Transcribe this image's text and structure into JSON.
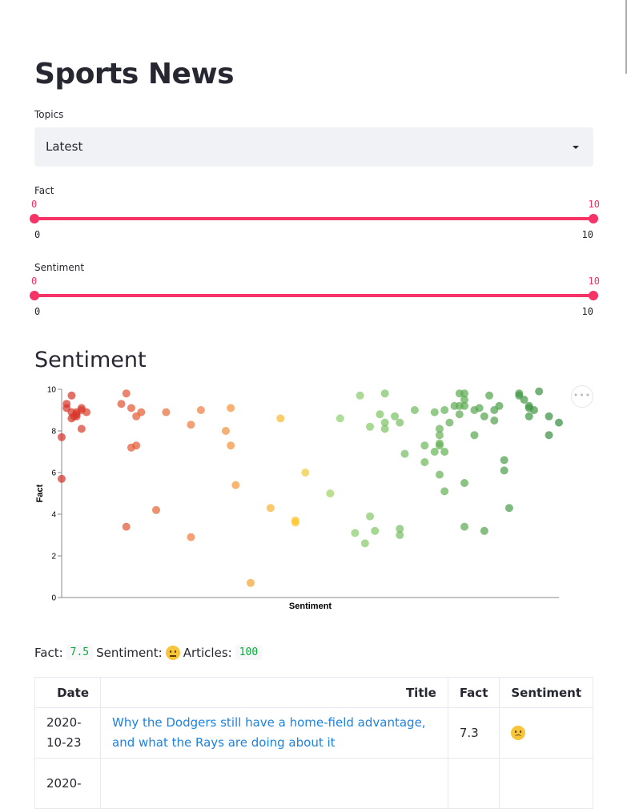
{
  "page": {
    "title": "Sports News"
  },
  "topics": {
    "label": "Topics",
    "selected": "Latest"
  },
  "sliders": [
    {
      "label": "Fact",
      "min": 0,
      "max": 10,
      "low": 0,
      "high": 10,
      "low_label": "0",
      "high_label": "10",
      "min_label": "0",
      "max_label": "10"
    },
    {
      "label": "Sentiment",
      "min": 0,
      "max": 10,
      "low": 0,
      "high": 10,
      "low_label": "0",
      "high_label": "10",
      "min_label": "0",
      "max_label": "10"
    }
  ],
  "section": {
    "heading": "Sentiment",
    "menu_icon": "ellipsis-icon"
  },
  "chart_data": {
    "type": "scatter",
    "title": "",
    "xlabel": "Sentiment",
    "ylabel": "Fact",
    "xlim": [
      0,
      10
    ],
    "ylim": [
      0,
      10
    ],
    "yticks": [
      "0",
      "2",
      "4",
      "6",
      "8",
      "10"
    ],
    "grid": false,
    "color_scale": "red-yellow-green by Sentiment",
    "points": [
      [
        0.0,
        7.7
      ],
      [
        0.0,
        5.7
      ],
      [
        0.1,
        9.3
      ],
      [
        0.1,
        9.1
      ],
      [
        0.2,
        9.7
      ],
      [
        0.2,
        8.9
      ],
      [
        0.2,
        8.6
      ],
      [
        0.25,
        8.7
      ],
      [
        0.3,
        8.9
      ],
      [
        0.3,
        8.7
      ],
      [
        0.3,
        8.8
      ],
      [
        0.4,
        9.1
      ],
      [
        0.4,
        9.0
      ],
      [
        0.4,
        8.1
      ],
      [
        0.5,
        8.9
      ],
      [
        1.2,
        9.3
      ],
      [
        1.3,
        9.8
      ],
      [
        1.4,
        9.1
      ],
      [
        1.5,
        8.7
      ],
      [
        1.6,
        8.9
      ],
      [
        1.4,
        7.2
      ],
      [
        1.5,
        7.3
      ],
      [
        1.3,
        3.4
      ],
      [
        1.9,
        4.2
      ],
      [
        2.1,
        8.9
      ],
      [
        2.6,
        8.3
      ],
      [
        2.8,
        9.0
      ],
      [
        2.6,
        2.9
      ],
      [
        3.3,
        8.0
      ],
      [
        3.4,
        9.1
      ],
      [
        3.4,
        7.3
      ],
      [
        3.5,
        5.4
      ],
      [
        3.8,
        0.7
      ],
      [
        4.2,
        4.3
      ],
      [
        4.4,
        8.6
      ],
      [
        4.7,
        3.7
      ],
      [
        4.7,
        3.6
      ],
      [
        4.9,
        6.0
      ],
      [
        5.4,
        5.0
      ],
      [
        5.6,
        8.6
      ],
      [
        6.0,
        9.7
      ],
      [
        6.5,
        9.8
      ],
      [
        6.2,
        8.2
      ],
      [
        6.4,
        8.8
      ],
      [
        6.5,
        8.4
      ],
      [
        6.5,
        8.1
      ],
      [
        6.7,
        8.7
      ],
      [
        6.8,
        8.4
      ],
      [
        7.1,
        9.0
      ],
      [
        5.9,
        3.1
      ],
      [
        6.1,
        2.6
      ],
      [
        6.2,
        3.9
      ],
      [
        6.3,
        3.2
      ],
      [
        6.8,
        3.3
      ],
      [
        6.8,
        3.0
      ],
      [
        6.9,
        6.9
      ],
      [
        7.3,
        7.3
      ],
      [
        7.3,
        6.5
      ],
      [
        7.5,
        8.9
      ],
      [
        7.5,
        7.0
      ],
      [
        7.6,
        8.1
      ],
      [
        7.6,
        7.8
      ],
      [
        7.6,
        7.4
      ],
      [
        7.6,
        7.3
      ],
      [
        7.6,
        5.9
      ],
      [
        7.7,
        9.0
      ],
      [
        7.7,
        7.0
      ],
      [
        7.7,
        5.1
      ],
      [
        7.8,
        8.4
      ],
      [
        7.9,
        9.2
      ],
      [
        8.0,
        9.8
      ],
      [
        8.0,
        9.2
      ],
      [
        8.0,
        8.8
      ],
      [
        8.1,
        9.8
      ],
      [
        8.1,
        9.5
      ],
      [
        8.1,
        9.2
      ],
      [
        8.1,
        5.5
      ],
      [
        8.1,
        3.4
      ],
      [
        8.3,
        7.8
      ],
      [
        8.3,
        9.0
      ],
      [
        8.4,
        9.1
      ],
      [
        8.5,
        8.7
      ],
      [
        8.5,
        3.2
      ],
      [
        8.6,
        9.7
      ],
      [
        8.7,
        9.0
      ],
      [
        8.7,
        8.5
      ],
      [
        8.8,
        9.2
      ],
      [
        8.9,
        6.6
      ],
      [
        8.9,
        6.1
      ],
      [
        9.0,
        4.3
      ],
      [
        9.2,
        9.8
      ],
      [
        9.2,
        9.7
      ],
      [
        9.3,
        9.5
      ],
      [
        9.4,
        9.2
      ],
      [
        9.4,
        9.1
      ],
      [
        9.4,
        8.7
      ],
      [
        9.5,
        9.0
      ],
      [
        9.6,
        9.9
      ],
      [
        9.8,
        8.7
      ],
      [
        9.8,
        7.8
      ],
      [
        10.0,
        8.4
      ]
    ]
  },
  "summary": {
    "fact_label": "Fact:",
    "fact_value": "7.5",
    "sentiment_label": "Sentiment:",
    "sentiment_icon": "neutral-face-icon",
    "articles_label": "Articles:",
    "articles_value": "100"
  },
  "table": {
    "headers": [
      "Date",
      "Title",
      "Fact",
      "Sentiment"
    ],
    "rows": [
      {
        "date": "2020-10-23",
        "title": "Why the Dodgers still have a home-field advantage, and what the Rays are doing about it",
        "fact": "7.3",
        "sentiment_icon": "slightly-frowning-face-icon"
      },
      {
        "date": "2020-",
        "title": "",
        "fact": "",
        "sentiment_icon": ""
      }
    ]
  }
}
